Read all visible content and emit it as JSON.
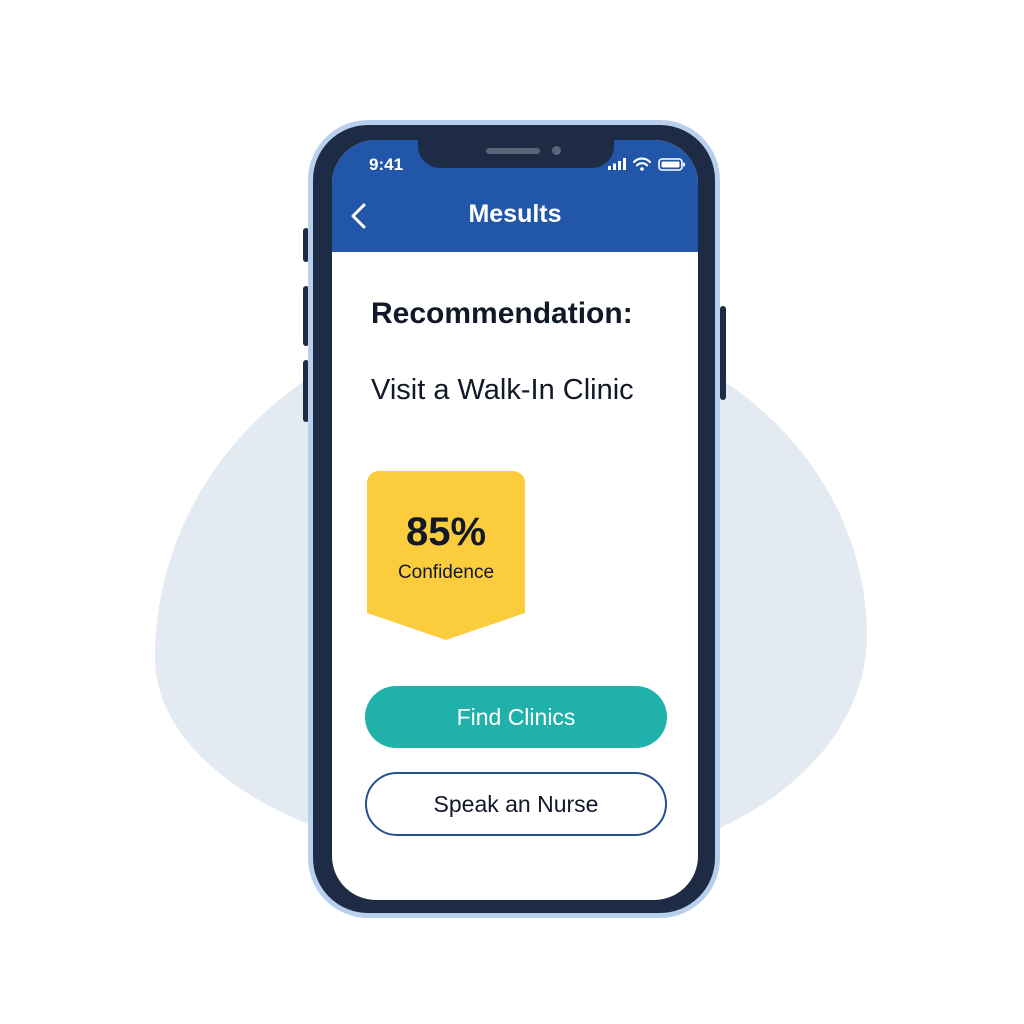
{
  "status_bar": {
    "time": "9:41"
  },
  "nav": {
    "title": "Mesults",
    "back_icon": "chevron-left-icon"
  },
  "recommendation": {
    "label": "Recommendation:",
    "value": "Visit a Walk-In Clinic"
  },
  "confidence": {
    "value": "85%",
    "caption": "Confidence"
  },
  "actions": {
    "primary_label": "Find Clinics",
    "secondary_label": "Speak an Nurse"
  },
  "colors": {
    "header_blue": "#2256a8",
    "badge_yellow": "#fbcd3d",
    "primary_teal": "#1fb1aa",
    "phone_frame": "#1e2b45",
    "background_blob": "#e3eaf2"
  }
}
